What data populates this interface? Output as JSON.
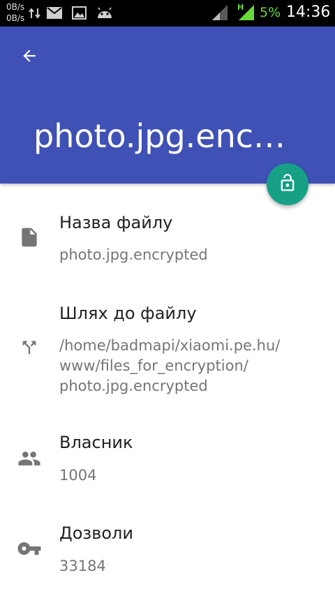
{
  "status_bar": {
    "net_up": "0B/s",
    "net_down": "0B/s",
    "network_type": "H",
    "battery": "5%",
    "time": "14:36",
    "icons": [
      "data-transfer-icon",
      "mail-icon",
      "image-icon",
      "android-icon",
      "wifi-signal-icon",
      "cell-signal-icon"
    ]
  },
  "app_bar": {
    "title": "photo.jpg.encr…",
    "color": "#3f51b5"
  },
  "fab": {
    "icon": "unlock-icon",
    "color": "#16a085"
  },
  "details": [
    {
      "icon": "file-icon",
      "label": "Назва файлу",
      "value": "photo.jpg.encrypted"
    },
    {
      "icon": "path-split-icon",
      "label": "Шлях до файлу",
      "value_lines": [
        "/home/badmapi/xiaomi.pe.hu/",
        "www/files_for_encryption/",
        "photo.jpg.encrypted"
      ]
    },
    {
      "icon": "people-icon",
      "label": "Власник",
      "value": "1004"
    },
    {
      "icon": "key-icon",
      "label": "Дозволи",
      "value": "33184"
    }
  ]
}
